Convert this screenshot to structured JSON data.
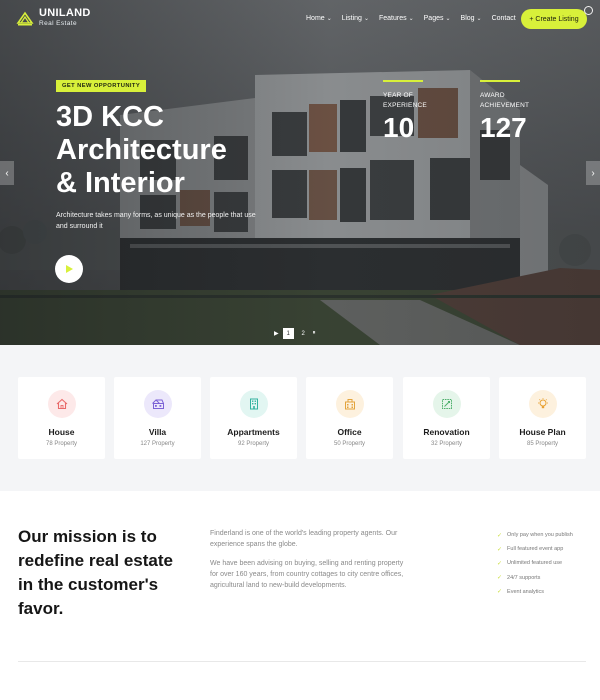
{
  "brand": {
    "name": "UNILAND",
    "subtitle": "Real Estate",
    "accent": "#d8f03a"
  },
  "nav": {
    "items": [
      {
        "label": "Home",
        "dropdown": true
      },
      {
        "label": "Listing",
        "dropdown": true
      },
      {
        "label": "Features",
        "dropdown": true
      },
      {
        "label": "Pages",
        "dropdown": true
      },
      {
        "label": "Blog",
        "dropdown": true
      },
      {
        "label": "Contact",
        "dropdown": false
      }
    ],
    "cta_label": "+ Create Listing"
  },
  "hero": {
    "tag": "GET NEW OPPORTUNITY",
    "title_lines": [
      "3D KCC",
      "Architecture",
      "& Interior"
    ],
    "description": "Architecture takes many forms, as unique as the people that use and surround it",
    "stats": [
      {
        "label": "YEAR OF EXPERIENCE",
        "value": "10"
      },
      {
        "label": "AWARD ACHIEVEMENT",
        "value": "127"
      }
    ],
    "pager": {
      "pages": [
        "1",
        "2"
      ],
      "active": "1"
    }
  },
  "categories": [
    {
      "name": "House",
      "count": "78 Property",
      "icon": "house-icon",
      "color": "#e96a6a",
      "bg": "#fde9e9"
    },
    {
      "name": "Villa",
      "count": "127 Property",
      "icon": "villa-icon",
      "color": "#7b62d6",
      "bg": "#ece8fb"
    },
    {
      "name": "Appartments",
      "count": "92 Property",
      "icon": "apartment-icon",
      "color": "#34b3a0",
      "bg": "#e2f6f2"
    },
    {
      "name": "Office",
      "count": "50 Property",
      "icon": "office-icon",
      "color": "#e3a43c",
      "bg": "#fdf1de"
    },
    {
      "name": "Renovation",
      "count": "32 Property",
      "icon": "renovation-icon",
      "color": "#4fb06d",
      "bg": "#e5f5ea"
    },
    {
      "name": "House Plan",
      "count": "85 Property",
      "icon": "lightbulb-icon",
      "color": "#e8a030",
      "bg": "#fdf1de"
    }
  ],
  "mission": {
    "title_lines": [
      "Our mission is to",
      "redefine real estate",
      "in the customer's",
      "favor."
    ],
    "paragraphs": [
      "Finderland is one of the world's leading property agents. Our experience spans the globe.",
      "We have been advising on buying, selling and renting property for over 160 years, from country cottages to city centre offices, agricultural land to new-build developments."
    ],
    "features": [
      "Only pay when you publish",
      "Full featured event app",
      "Unlimited featured use",
      "24/7 supports",
      "Event analytics"
    ]
  }
}
